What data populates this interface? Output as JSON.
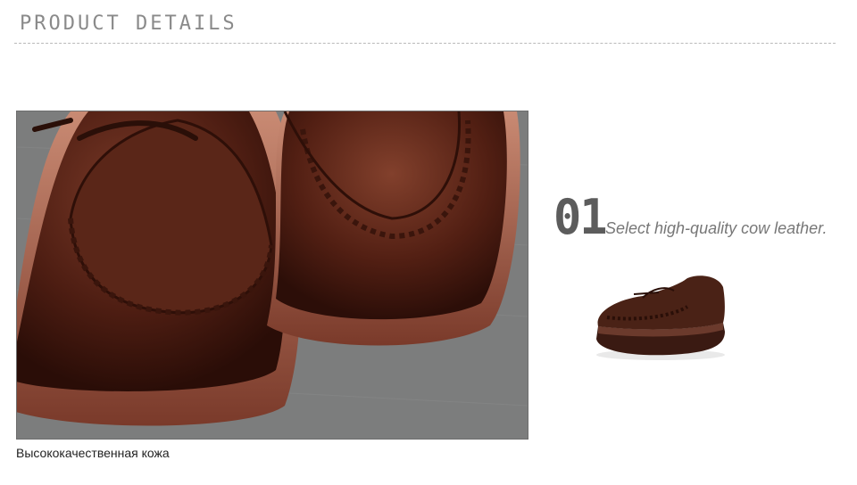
{
  "header": {
    "title": "PRODUCT DETAILS"
  },
  "photo": {
    "caption": "Высококачественная кожа"
  },
  "feature": {
    "number": "01",
    "text": "Select high-quality cow leather."
  },
  "colors": {
    "leather": "#4a1f14",
    "sole": "#b4705a",
    "background_gray": "#7c7d7d",
    "title_gray": "#8a8a8a"
  }
}
